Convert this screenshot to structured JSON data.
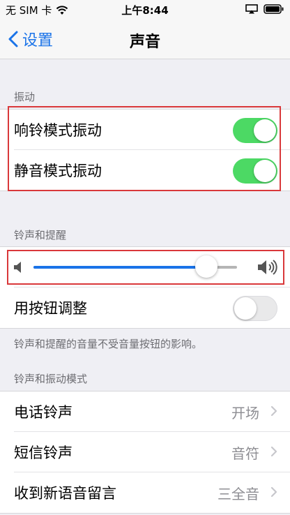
{
  "status_bar": {
    "carrier": "无 SIM 卡",
    "time": "上午8:44"
  },
  "nav": {
    "back_label": "设置",
    "title": "声音"
  },
  "vibration": {
    "header": "振动",
    "items": [
      {
        "label": "响铃模式振动",
        "on": true
      },
      {
        "label": "静音模式振动",
        "on": true
      }
    ]
  },
  "ringtone": {
    "header": "铃声和提醒",
    "volume": 0.85,
    "adjust_with_buttons": {
      "label": "用按钮调整",
      "on": false
    },
    "note": "铃声和提醒的音量不受音量按钮的影响。"
  },
  "patterns": {
    "header": "铃声和振动模式",
    "items": [
      {
        "label": "电话铃声",
        "value": "开场"
      },
      {
        "label": "短信铃声",
        "value": "音符"
      },
      {
        "label": "收到新语音留言",
        "value": "三全音"
      }
    ]
  },
  "colors": {
    "accent": "#1a73e8",
    "toggle_on": "#4cd964",
    "highlight_box": "#d9383a"
  }
}
